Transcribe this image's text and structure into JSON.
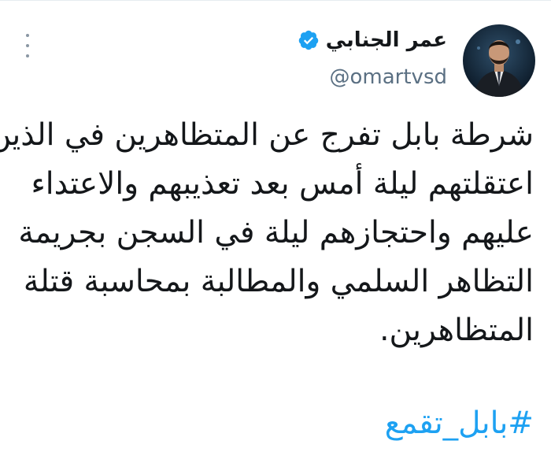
{
  "author": {
    "display_name": "عمر الجنابي",
    "handle": "@omartvsd",
    "verified": true
  },
  "tweet": {
    "text_lines": [
      "شرطة بابل تفرج عن المتظاهرين في الذين",
      "اعتقلتهم ليلة أمس بعد تعذيبهم والاعتداء",
      "عليهم واحتجازهم ليلة في السجن بجريمة",
      "التظاهر السلمي والمطالبة بمحاسبة قتلة",
      "المتظاهرين."
    ],
    "hashtag": "#بابل_تقمع"
  },
  "colors": {
    "link": "#1da1f2",
    "verified": "#1da1f2",
    "handle": "#5b7083",
    "text": "#14171a"
  },
  "icons": {
    "more": "more-vertical-icon",
    "verified": "verified-badge-icon"
  }
}
